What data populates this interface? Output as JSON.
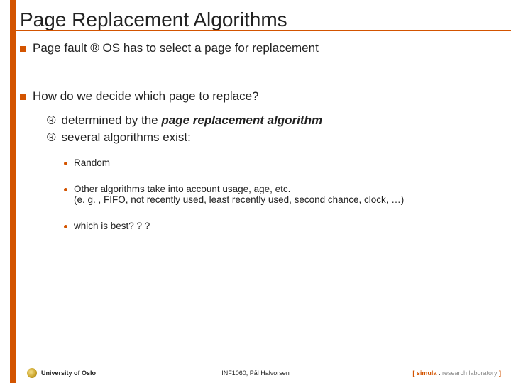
{
  "title": "Page Replacement Algorithms",
  "bullets": {
    "b1_pre": "Page fault ",
    "b1_post": " OS has to select a page for replacement",
    "b2": "How do we decide which page to replace?"
  },
  "arrows": {
    "r": "®"
  },
  "sub": {
    "s1_pre": "determined by the ",
    "s1_emph": "page replacement algorithm",
    "s2": "several algorithms exist:"
  },
  "dots": {
    "d1": "Random",
    "d2_l1": "Other algorithms take into account usage, age, etc.",
    "d2_l2": "(e. g. , FIFO, not recently used, least recently used, second chance, clock, …)",
    "d3": "which is best? ? ?"
  },
  "footer": {
    "left": "University of Oslo",
    "center": "INF1060,   Pål Halvorsen",
    "right_open": "[ ",
    "right_simula": "simula",
    "right_sep": " . ",
    "right_lab": "research laboratory",
    "right_close": " ]"
  }
}
